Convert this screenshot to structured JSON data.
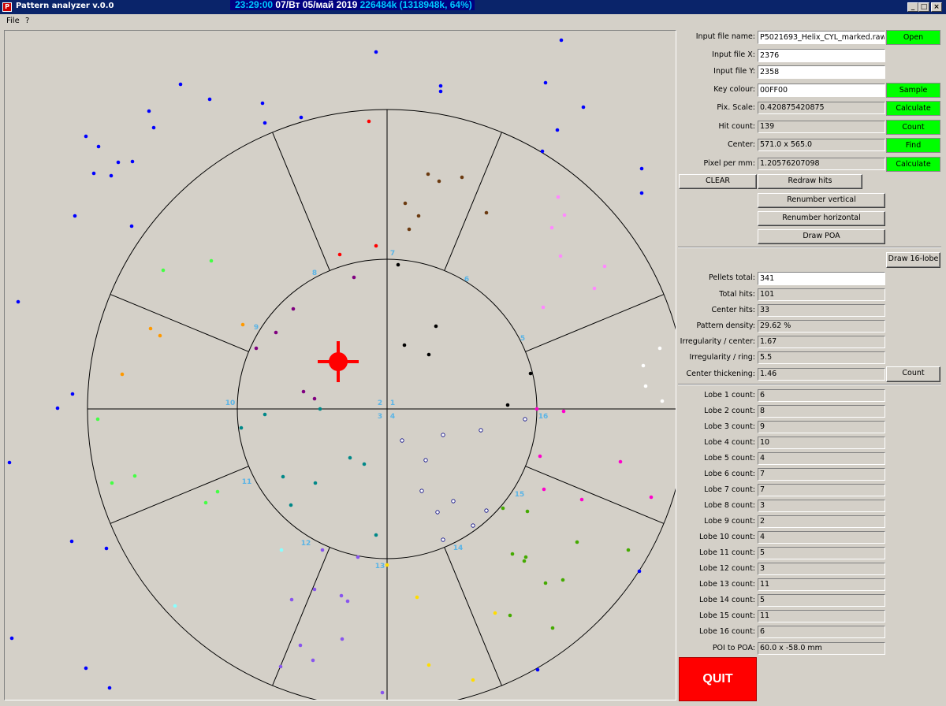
{
  "window": {
    "title": "Pattern analyzer v.0.0",
    "clock_time": "23:29:00",
    "clock_date": "07/Вт 05/май 2019",
    "clock_mem": "226484k (1318948k, 64%)",
    "minimize_label": "_",
    "maximize_label": "□",
    "close_label": "×"
  },
  "menu": [
    "File",
    "?"
  ],
  "fields": {
    "input_file_name": {
      "label": "Input file name:",
      "value": "P5021693_Helix_CYL_marked.raw",
      "button": "Open"
    },
    "input_file_x": {
      "label": "Input file X:",
      "value": "2376"
    },
    "input_file_y": {
      "label": "Input file Y:",
      "value": "2358"
    },
    "key_colour": {
      "label": "Key colour:",
      "value": "00FF00",
      "button": "Sample"
    },
    "pix_scale": {
      "label": "Pix. Scale:",
      "value": "0.420875420875",
      "button": "Calculate"
    },
    "hit_count": {
      "label": "Hit count:",
      "value": "139",
      "button": "Count"
    },
    "center": {
      "label": "Center:",
      "value": "571.0 x 565.0",
      "button": "Find"
    },
    "pixel_per_mm": {
      "label": "Pixel per mm:",
      "value": "1.20576207098",
      "button": "Calculate"
    }
  },
  "buttons": {
    "clear": "CLEAR",
    "redraw_hits": "Redraw hits",
    "renumber_vertical": "Renumber vertical",
    "renumber_horizontal": "Renumber horizontal",
    "draw_poa": "Draw POA",
    "draw_16_lobe": "Draw 16-lobe",
    "count": "Count",
    "quit": "QUIT"
  },
  "stats": [
    {
      "label": "Pellets total:",
      "value": "341",
      "editable": true
    },
    {
      "label": "Total hits:",
      "value": "101"
    },
    {
      "label": "Center hits:",
      "value": "33"
    },
    {
      "label": "Pattern density:",
      "value": "29.62 %"
    },
    {
      "label": "Irregularity / center:",
      "value": "1.67"
    },
    {
      "label": "Irregularity / ring:",
      "value": "5.5"
    },
    {
      "label": "Center thickening:",
      "value": "1.46"
    }
  ],
  "lobes": [
    {
      "label": "Lobe 1 count:",
      "value": "6"
    },
    {
      "label": "Lobe 2 count:",
      "value": "8"
    },
    {
      "label": "Lobe 3 count:",
      "value": "9"
    },
    {
      "label": "Lobe 4 count:",
      "value": "10"
    },
    {
      "label": "Lobe 5 count:",
      "value": "4"
    },
    {
      "label": "Lobe 6 count:",
      "value": "7"
    },
    {
      "label": "Lobe 7 count:",
      "value": "7"
    },
    {
      "label": "Lobe 8 count:",
      "value": "3"
    },
    {
      "label": "Lobe 9 count:",
      "value": "2"
    },
    {
      "label": "Lobe 10 count:",
      "value": "4"
    },
    {
      "label": "Lobe 11 count:",
      "value": "5"
    },
    {
      "label": "Lobe 12 count:",
      "value": "3"
    },
    {
      "label": "Lobe 13 count:",
      "value": "11"
    },
    {
      "label": "Lobe 14 count:",
      "value": "5"
    },
    {
      "label": "Lobe 15 count:",
      "value": "11"
    },
    {
      "label": "Lobe 16 count:",
      "value": "6"
    }
  ],
  "poi_to_poa": {
    "label": "POI to POA:",
    "value": "60.0 x -58.0 mm"
  },
  "target": {
    "lobe_numbers": [
      "1",
      "2",
      "3",
      "4",
      "5",
      "6",
      "7",
      "8",
      "9",
      "10",
      "11",
      "12",
      "13",
      "14",
      "15",
      "16"
    ],
    "colors": {
      "ring": "#000000",
      "poa": "#ff0000",
      "lobe_number": "#5ab4e6"
    }
  },
  "hit_colors": {
    "blue": "#0000ff",
    "red": "#ff0000",
    "brown": "#6b3a10",
    "pink": "#ff88ff",
    "green": "#44ff44",
    "orange": "#ff9900",
    "purple": "#800080",
    "black": "#000000",
    "white": "#ffffff",
    "magenta": "#ff00cc",
    "teal": "#008888",
    "cyan": "#88ffff",
    "violet": "#8855ee",
    "olive": "#44aa00",
    "yellow": "#ffdd00"
  }
}
